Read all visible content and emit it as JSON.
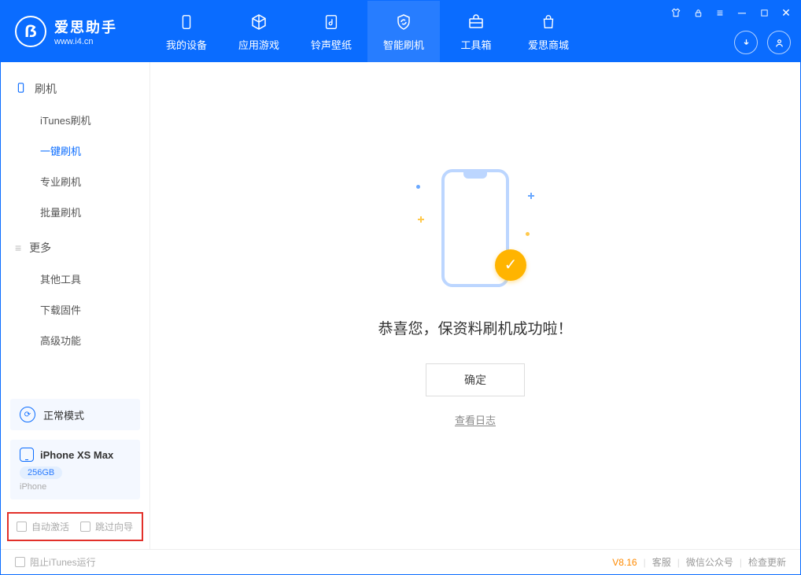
{
  "app": {
    "name": "爱思助手",
    "url": "www.i4.cn"
  },
  "nav": {
    "tabs": [
      {
        "label": "我的设备"
      },
      {
        "label": "应用游戏"
      },
      {
        "label": "铃声壁纸"
      },
      {
        "label": "智能刷机"
      },
      {
        "label": "工具箱"
      },
      {
        "label": "爱思商城"
      }
    ]
  },
  "sidebar": {
    "section1": {
      "title": "刷机",
      "items": [
        "iTunes刷机",
        "一键刷机",
        "专业刷机",
        "批量刷机"
      ]
    },
    "section2": {
      "title": "更多",
      "items": [
        "其他工具",
        "下载固件",
        "高级功能"
      ]
    }
  },
  "mode": {
    "label": "正常模式"
  },
  "device": {
    "name": "iPhone XS Max",
    "capacity": "256GB",
    "sub": "iPhone"
  },
  "options": {
    "auto_activate": "自动激活",
    "skip_guide": "跳过向导"
  },
  "main": {
    "success": "恭喜您，保资料刷机成功啦！",
    "ok": "确定",
    "view_log": "查看日志"
  },
  "status": {
    "block_itunes": "阻止iTunes运行",
    "version": "V8.16",
    "links": [
      "客服",
      "微信公众号",
      "检查更新"
    ]
  }
}
